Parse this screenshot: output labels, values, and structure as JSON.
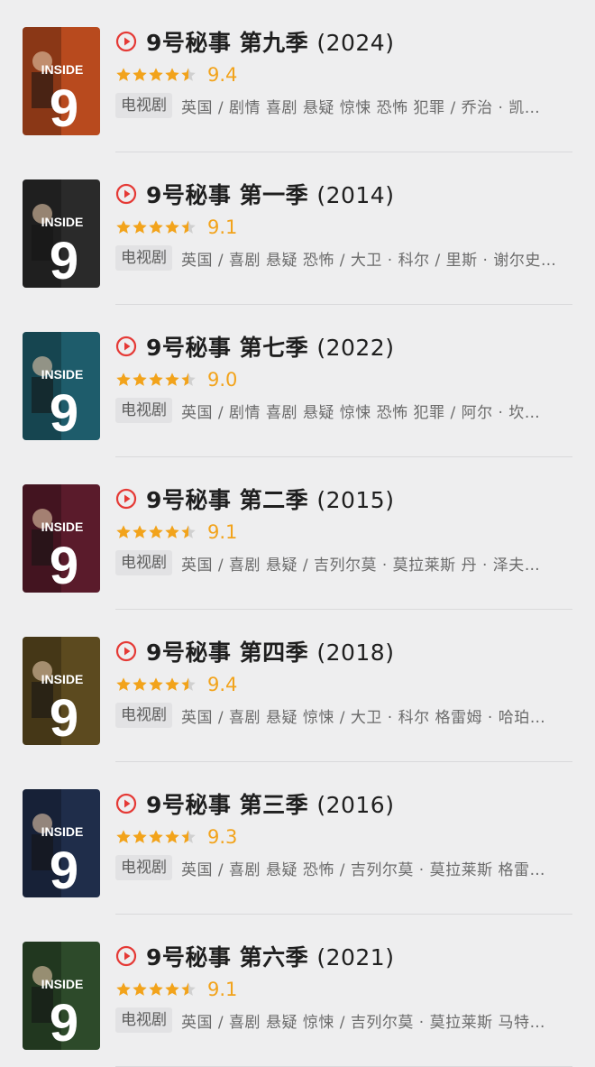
{
  "items": [
    {
      "title": "9号秘事 第九季",
      "year": "(2024)",
      "score": "9.4",
      "stars": 4.5,
      "tag": "电视剧",
      "meta": "英国 / 剧情 喜剧 悬疑 惊悚 恐怖 犯罪 / 乔治 · 凯…",
      "cover_color": "#b84a1e",
      "cover_text": "INSIDE",
      "cover_no": "9",
      "accent": "#e53935"
    },
    {
      "title": "9号秘事 第一季",
      "year": "(2014)",
      "score": "9.1",
      "stars": 4.5,
      "tag": "电视剧",
      "meta": "英国 / 喜剧 悬疑 恐怖 / 大卫 · 科尔 / 里斯 · 谢尔史…",
      "cover_color": "#2a2a2a",
      "cover_text": "INSIDE",
      "cover_no": "9",
      "accent": "#e53935"
    },
    {
      "title": "9号秘事 第七季",
      "year": "(2022)",
      "score": "9.0",
      "stars": 4.5,
      "tag": "电视剧",
      "meta": "英国 / 剧情 喜剧 悬疑 惊悚 恐怖 犯罪 / 阿尔 · 坎…",
      "cover_color": "#1e5c6b",
      "cover_text": "INSIDE",
      "cover_no": "9",
      "accent": "#e53935"
    },
    {
      "title": "9号秘事 第二季",
      "year": "(2015)",
      "score": "9.1",
      "stars": 4.5,
      "tag": "电视剧",
      "meta": "英国 / 喜剧 悬疑 / 吉列尔莫 · 莫拉莱斯 丹 · 泽夫…",
      "cover_color": "#5a1b2b",
      "cover_text": "INSIDE",
      "cover_no": "9",
      "accent": "#e53935"
    },
    {
      "title": "9号秘事 第四季",
      "year": "(2018)",
      "score": "9.4",
      "stars": 4.5,
      "tag": "电视剧",
      "meta": "英国 / 喜剧 悬疑 惊悚 / 大卫 · 科尔 格雷姆 · 哈珀…",
      "cover_color": "#5c4a1f",
      "cover_text": "INSIDE",
      "cover_no": "9",
      "accent": "#e53935"
    },
    {
      "title": "9号秘事 第三季",
      "year": "(2016)",
      "score": "9.3",
      "stars": 4.5,
      "tag": "电视剧",
      "meta": "英国 / 喜剧 悬疑 恐怖 / 吉列尔莫 · 莫拉莱斯 格雷…",
      "cover_color": "#1f2d4a",
      "cover_text": "INSIDE",
      "cover_no": "9",
      "accent": "#e53935"
    },
    {
      "title": "9号秘事 第六季",
      "year": "(2021)",
      "score": "9.1",
      "stars": 4.5,
      "tag": "电视剧",
      "meta": "英国 / 喜剧 悬疑 惊悚 / 吉列尔莫 · 莫拉莱斯 马特…",
      "cover_color": "#2d4a2a",
      "cover_text": "INSIDE",
      "cover_no": "9",
      "accent": "#e53935"
    }
  ],
  "colors": {
    "play_red": "#e53935",
    "star": "#f2a31b",
    "star_empty": "#d0d0d0"
  }
}
